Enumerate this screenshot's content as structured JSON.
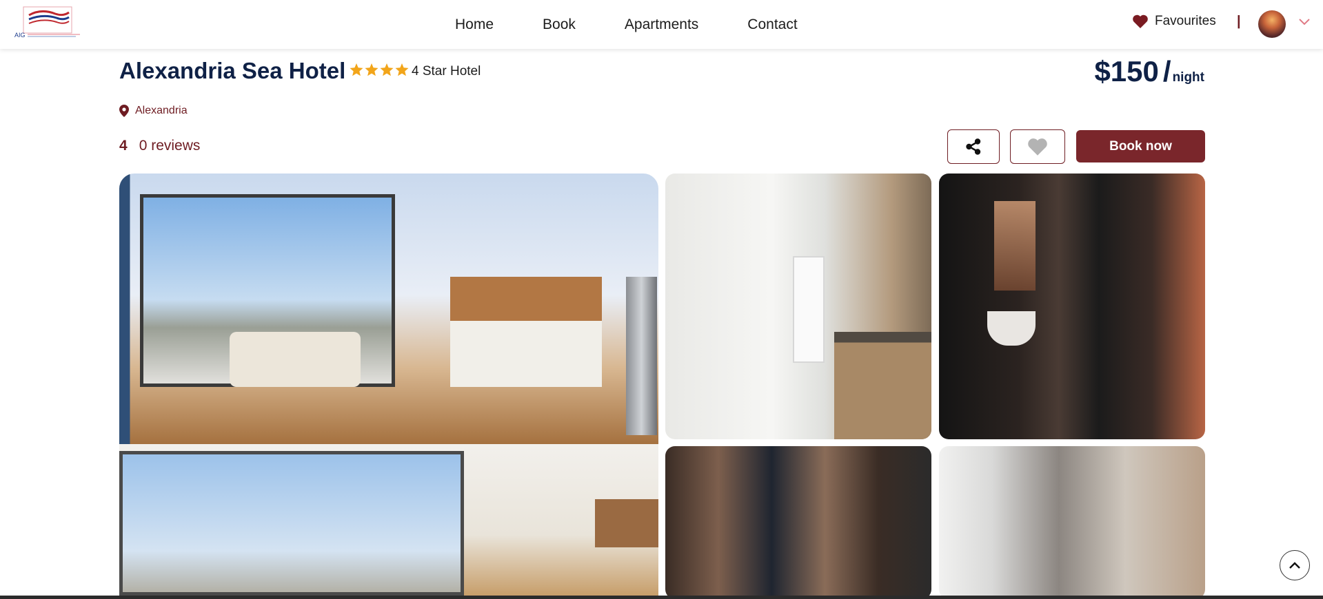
{
  "colors": {
    "brand": "#7a262b",
    "title": "#0f2146",
    "star": "#f2a51a"
  },
  "header": {
    "logo_text": "AIG",
    "nav": [
      {
        "label": "Home"
      },
      {
        "label": "Book"
      },
      {
        "label": "Apartments"
      },
      {
        "label": "Contact"
      }
    ],
    "favourites_label": "Favourites",
    "separator": "|",
    "avatar_icon": "user-avatar",
    "menu_icon": "chevron-down-icon"
  },
  "hotel": {
    "name": "Alexandria Sea Hotel",
    "star_count": 4,
    "star_label": "4 Star Hotel",
    "location": "Alexandria",
    "rating": "4",
    "reviews": "0 reviews"
  },
  "price": {
    "amount": "$150",
    "slash": "/",
    "unit": "night"
  },
  "actions": {
    "share_icon": "share-icon",
    "favourite_icon": "heart-icon",
    "book_label": "Book now"
  },
  "gallery": {
    "photos": [
      "living-room",
      "living-room-2",
      "bathroom-kitchen",
      "dark-suite",
      "bathroom-brown",
      "shower-room"
    ]
  },
  "scroll_top_icon": "chevron-up-icon"
}
